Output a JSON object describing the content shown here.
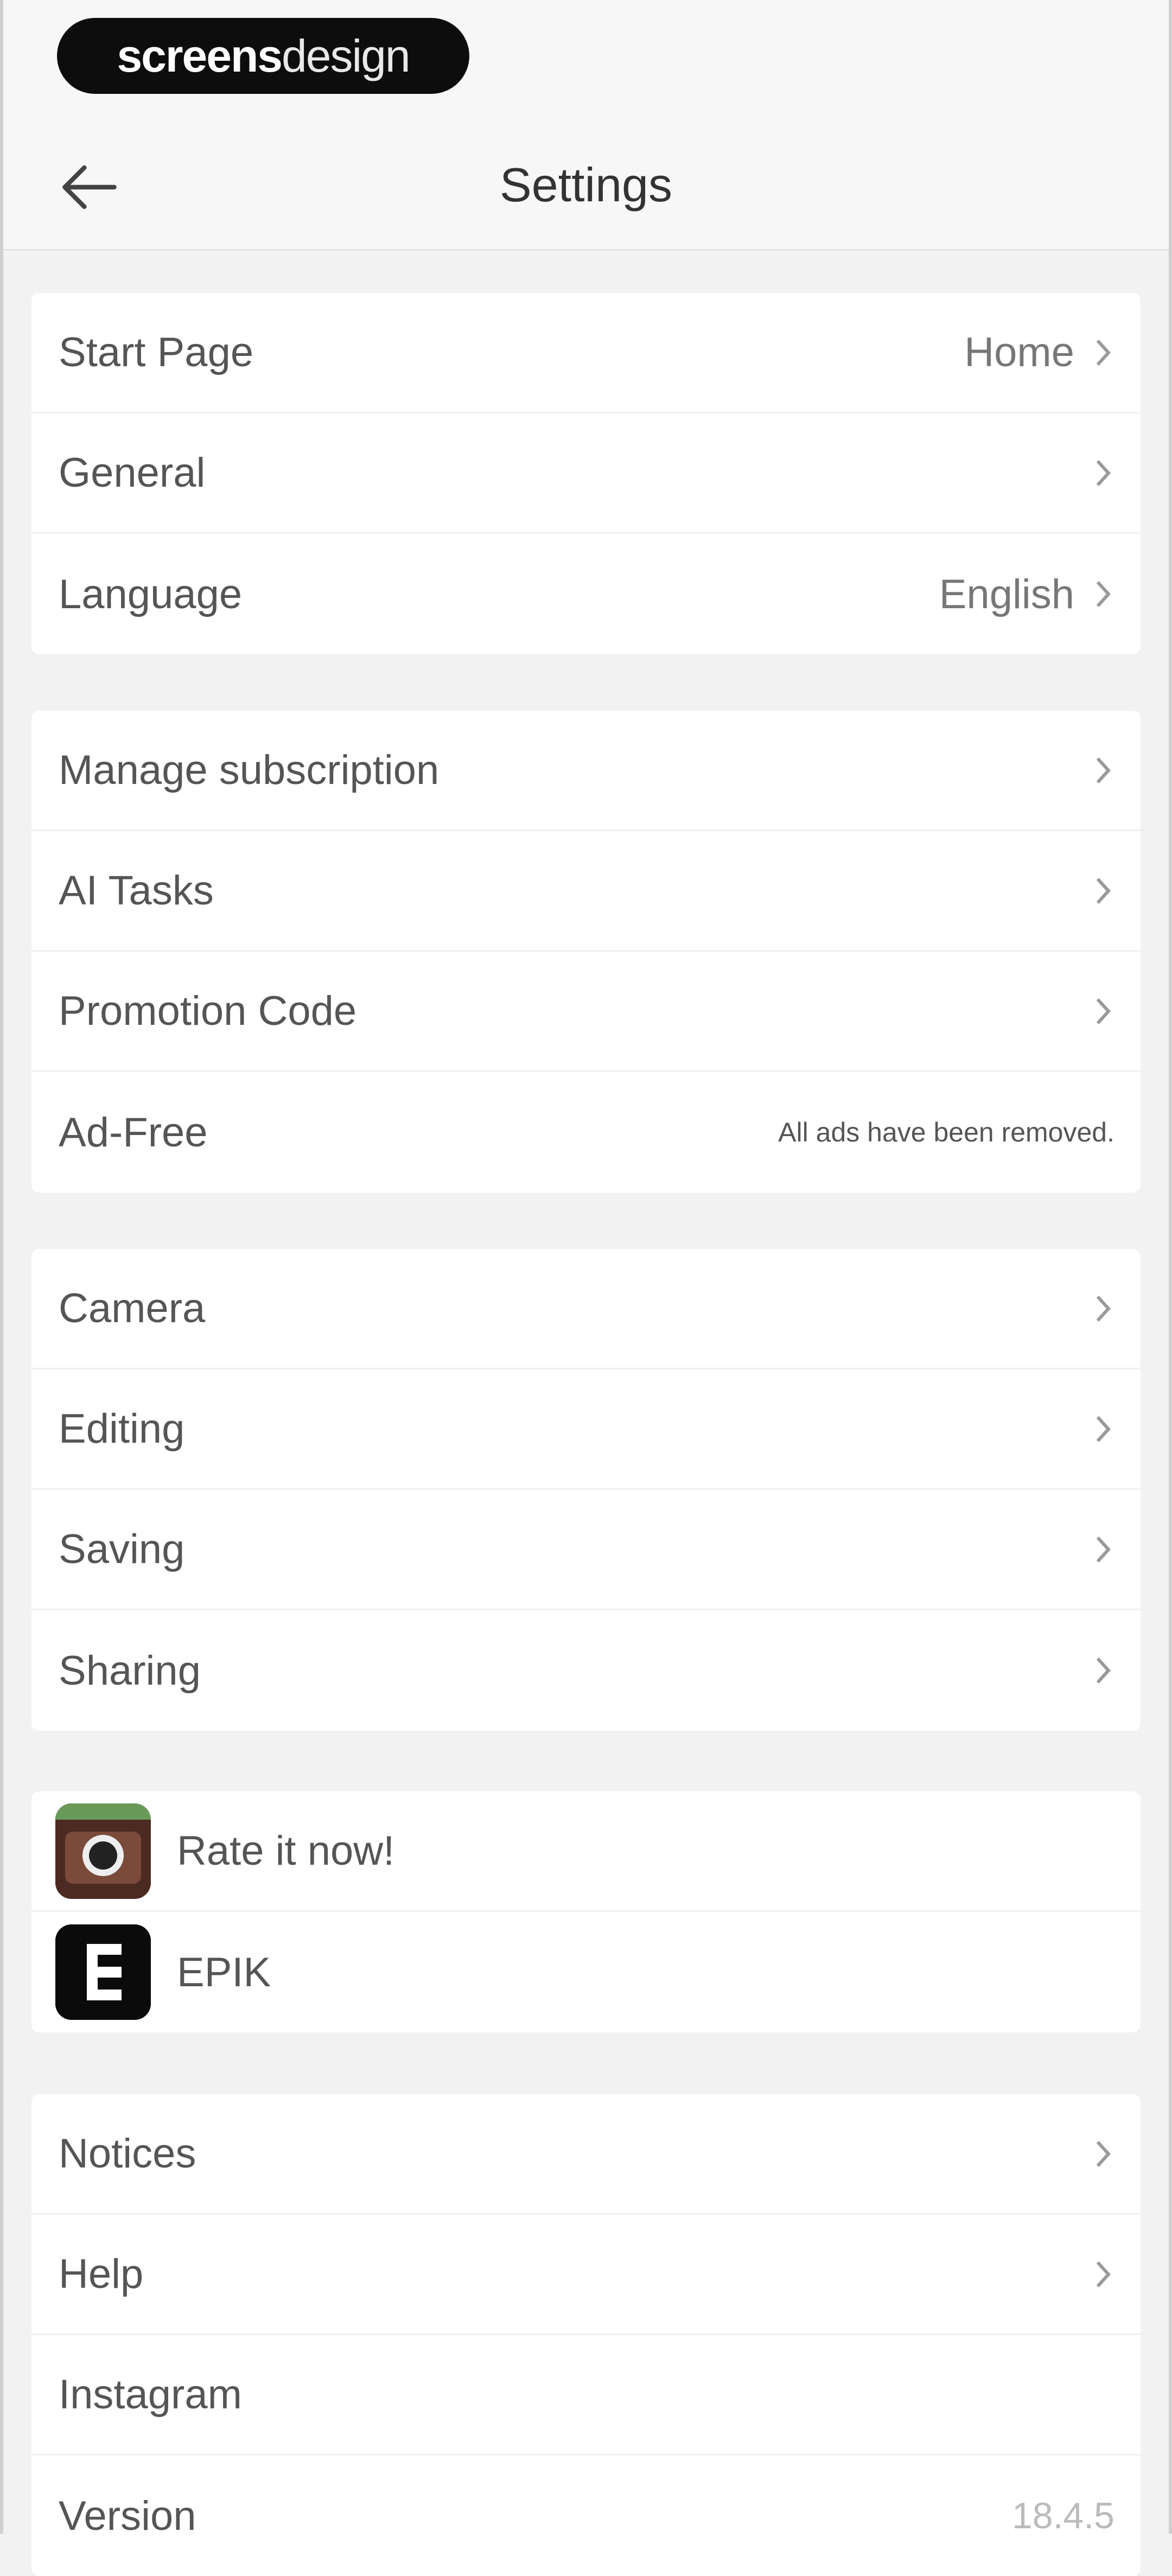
{
  "brand": {
    "part1": "screens",
    "part2": "design"
  },
  "header": {
    "title": "Settings",
    "back_icon": "back-arrow-icon"
  },
  "groups": {
    "general": [
      {
        "label": "Start Page",
        "value": "Home"
      },
      {
        "label": "General"
      },
      {
        "label": "Language",
        "value": "English"
      }
    ],
    "subscription": [
      {
        "label": "Manage subscription"
      },
      {
        "label": "AI Tasks"
      },
      {
        "label": "Promotion Code"
      },
      {
        "label": "Ad-Free",
        "note": "All ads have been removed."
      }
    ],
    "media": [
      {
        "label": "Camera"
      },
      {
        "label": "Editing"
      },
      {
        "label": "Saving"
      },
      {
        "label": "Sharing"
      }
    ],
    "apps": [
      {
        "label": "Rate it now!",
        "icon": "camera-app-icon"
      },
      {
        "label": "EPIK",
        "icon": "epik-app-icon"
      }
    ],
    "about": [
      {
        "label": "Notices"
      },
      {
        "label": "Help"
      },
      {
        "label": "Instagram"
      },
      {
        "label": "Version",
        "value": "18.4.5"
      }
    ]
  },
  "colors": {
    "background": "#f2f2f2",
    "card": "#ffffff",
    "brand_pill": "#0d0d0d"
  }
}
